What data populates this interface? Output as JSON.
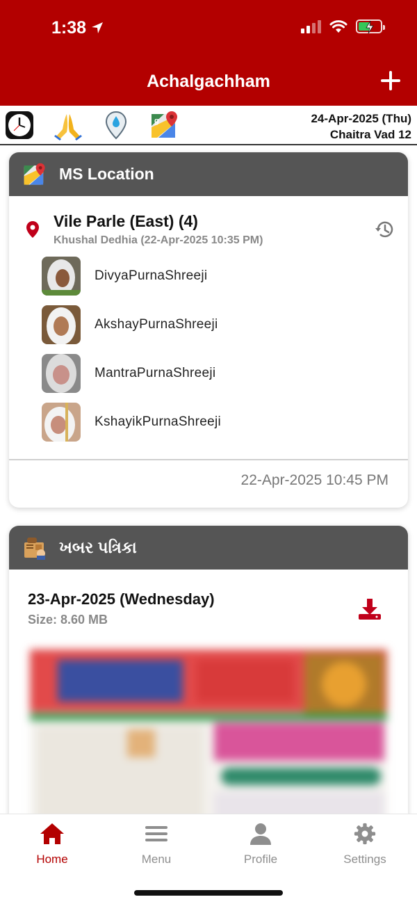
{
  "status_bar": {
    "time": "1:38"
  },
  "header": {
    "title": "Achalgachham"
  },
  "quick_bar": {
    "icons": [
      "clock-icon",
      "folded-hands-icon",
      "water-drop-pin-icon",
      "google-maps-icon"
    ],
    "date": "24-Apr-2025 (Thu)",
    "tithi": "Chaitra Vad 12"
  },
  "location_card": {
    "title": "MS Location",
    "place": "Vile Parle (East) (4)",
    "updated_by": "Khushal Dedhia (22-Apr-2025 10:35 PM)",
    "members": [
      {
        "name": "DivyaPurnaShreeji"
      },
      {
        "name": "AkshayPurnaShreeji"
      },
      {
        "name": "MantraPurnaShreeji"
      },
      {
        "name": "KshayikPurnaShreeji"
      }
    ],
    "footer_time": "22-Apr-2025 10:45 PM"
  },
  "news_card": {
    "title": "ખબર પત્રિકા",
    "date": "23-Apr-2025 (Wednesday)",
    "size": "Size: 8.60 MB"
  },
  "tabs": [
    {
      "label": "Home",
      "icon": "home-icon",
      "active": true
    },
    {
      "label": "Menu",
      "icon": "menu-icon",
      "active": false
    },
    {
      "label": "Profile",
      "icon": "profile-icon",
      "active": false
    },
    {
      "label": "Settings",
      "icon": "settings-icon",
      "active": false
    }
  ],
  "colors": {
    "brand": "#b30000",
    "card_header": "#555555",
    "battery": "#34c759"
  }
}
